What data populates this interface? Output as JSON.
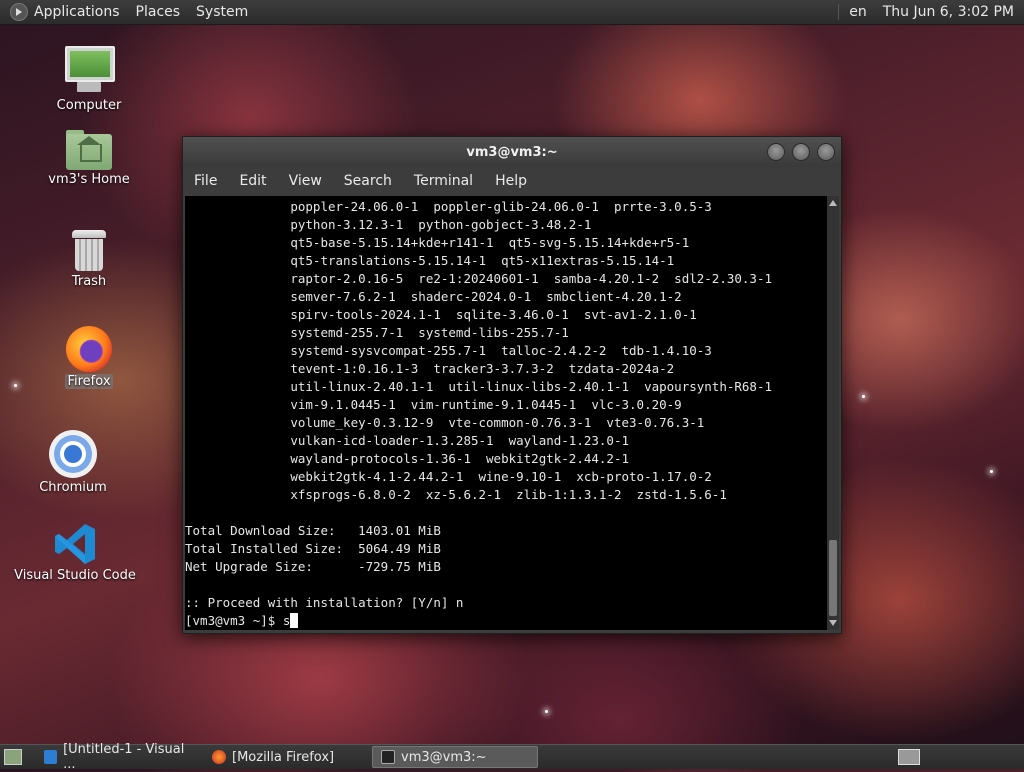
{
  "top_panel": {
    "menus": [
      "Applications",
      "Places",
      "System"
    ],
    "keyboard_layout": "en",
    "clock": "Thu Jun  6,  3:02 PM"
  },
  "desktop_icons": [
    {
      "label": "Computer",
      "icon": "computer-icon"
    },
    {
      "label": "vm3's Home",
      "icon": "home-folder-icon"
    },
    {
      "label": "Trash",
      "icon": "trash-icon"
    },
    {
      "label": "Firefox",
      "icon": "firefox-icon",
      "selected": true
    },
    {
      "label": "Chromium",
      "icon": "chromium-icon"
    },
    {
      "label": "Visual Studio Code",
      "icon": "vscode-icon"
    }
  ],
  "terminal": {
    "title": "vm3@vm3:~",
    "menu": [
      "File",
      "Edit",
      "View",
      "Search",
      "Terminal",
      "Help"
    ],
    "lines": [
      "              poppler-24.06.0-1  poppler-glib-24.06.0-1  prrte-3.0.5-3",
      "              python-3.12.3-1  python-gobject-3.48.2-1",
      "              qt5-base-5.15.14+kde+r141-1  qt5-svg-5.15.14+kde+r5-1",
      "              qt5-translations-5.15.14-1  qt5-x11extras-5.15.14-1",
      "              raptor-2.0.16-5  re2-1:20240601-1  samba-4.20.1-2  sdl2-2.30.3-1",
      "              semver-7.6.2-1  shaderc-2024.0-1  smbclient-4.20.1-2",
      "              spirv-tools-2024.1-1  sqlite-3.46.0-1  svt-av1-2.1.0-1",
      "              systemd-255.7-1  systemd-libs-255.7-1",
      "              systemd-sysvcompat-255.7-1  talloc-2.4.2-2  tdb-1.4.10-3",
      "              tevent-1:0.16.1-3  tracker3-3.7.3-2  tzdata-2024a-2",
      "              util-linux-2.40.1-1  util-linux-libs-2.40.1-1  vapoursynth-R68-1",
      "              vim-9.1.0445-1  vim-runtime-9.1.0445-1  vlc-3.0.20-9",
      "              volume_key-0.3.12-9  vte-common-0.76.3-1  vte3-0.76.3-1",
      "              vulkan-icd-loader-1.3.285-1  wayland-1.23.0-1",
      "              wayland-protocols-1.36-1  webkit2gtk-2.44.2-1",
      "              webkit2gtk-4.1-2.44.2-1  wine-9.10-1  xcb-proto-1.17.0-2",
      "              xfsprogs-6.8.0-2  xz-5.6.2-1  zlib-1:1.3.1-2  zstd-1.5.6-1",
      "",
      "Total Download Size:   1403.01 MiB",
      "Total Installed Size:  5064.49 MiB",
      "Net Upgrade Size:      -729.75 MiB",
      "",
      ":: Proceed with installation? [Y/n] n"
    ],
    "prompt": "[vm3@vm3 ~]$ s"
  },
  "taskbar": {
    "tasks": [
      {
        "label": "[Untitled-1 - Visual ...",
        "icon": "vscode-icon",
        "active": false
      },
      {
        "label": "[Mozilla Firefox]",
        "icon": "firefox-icon",
        "active": false
      },
      {
        "label": "vm3@vm3:~",
        "icon": "terminal-icon",
        "active": true
      }
    ]
  }
}
